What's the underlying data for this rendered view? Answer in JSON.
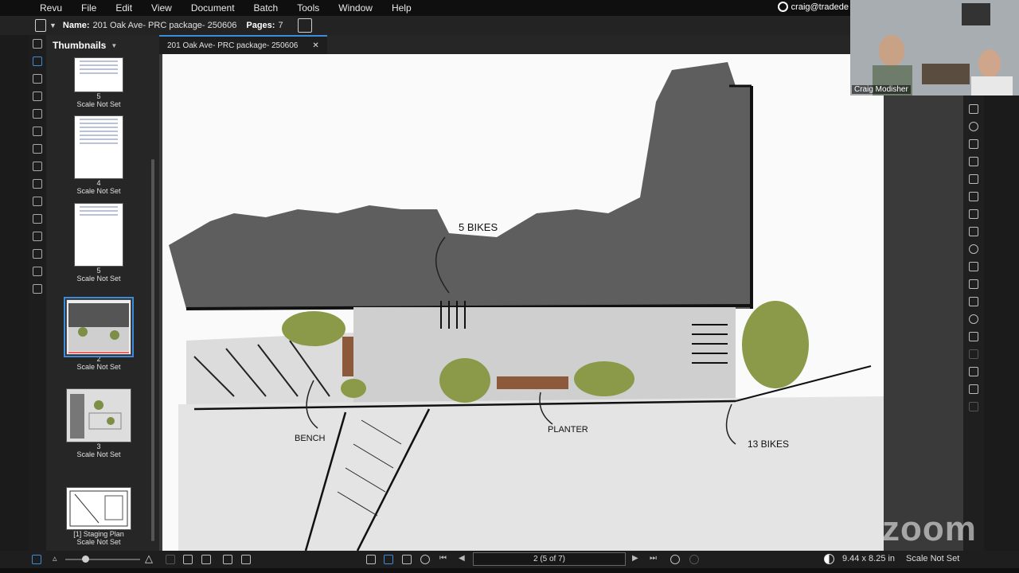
{
  "menu": [
    "Revu",
    "File",
    "Edit",
    "View",
    "Document",
    "Batch",
    "Tools",
    "Window",
    "Help"
  ],
  "user": "craig@tradede",
  "doc": {
    "name_label": "Name:",
    "name_value": "201 Oak Ave- PRC package- 250606",
    "pages_label": "Pages:",
    "pages_value": "7"
  },
  "panel": {
    "title": "Thumbnails"
  },
  "thumbnails": [
    {
      "page": "5",
      "scale": "Scale Not Set"
    },
    {
      "page": "4",
      "scale": "Scale Not Set"
    },
    {
      "page": "5",
      "scale": "Scale Not Set"
    },
    {
      "page": "2",
      "scale": "Scale Not Set"
    },
    {
      "page": "3",
      "scale": "Scale Not Set"
    },
    {
      "page": "[1] Staging Plan",
      "scale": "Scale Not Set"
    }
  ],
  "tab": {
    "label": "201 Oak Ave- PRC package- 250606"
  },
  "sketch": {
    "label_top": "5 BIKES",
    "label_bench": "BENCH",
    "label_planter": "PLANTER",
    "label_right": "13 BIKES"
  },
  "video": {
    "name": "Craig Modisher"
  },
  "status": {
    "page_indicator": "2 (5 of 7)",
    "dimensions": "9.44 x 8.25 in",
    "scale": "Scale Not Set"
  },
  "watermark": "zoom"
}
